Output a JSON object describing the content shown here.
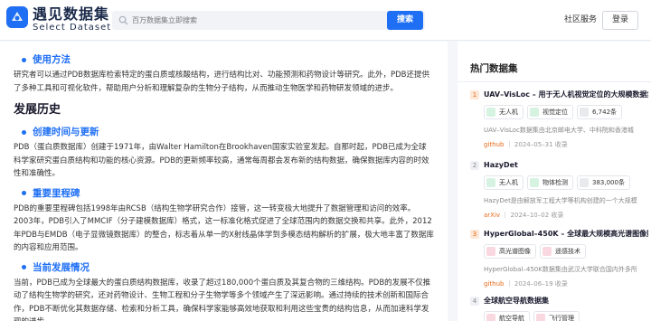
{
  "header": {
    "brand_cn": "遇见数据集",
    "brand_en": "Select Dataset",
    "search_placeholder": "百万数据集立即搜索",
    "search_button": "搜索",
    "nav_community": "社区服务",
    "login_button": "登录"
  },
  "main": {
    "usage": {
      "heading": "使用方法",
      "text": "研究者可以通过PDB数据库检索特定的蛋白质或核酸结构，进行结构比对、功能预测和药物设计等研究。此外，PDB还提供了多种工具和可视化软件，帮助用户分析和理解复杂的生物分子结构，从而推动生物医学和药物研发领域的进步。"
    },
    "history_title": "发展历史",
    "creation": {
      "heading": "创建时间与更新",
      "text": "PDB（蛋白质数据库）创建于1971年，由Walter Hamilton在Brookhaven国家实验室发起。自那时起，PDB已成为全球科学家研究蛋白质结构和功能的核心资源。PDB的更新频率较高，通常每周都会发布新的结构数据，确保数据库内容的时效性和准确性。"
    },
    "milestones": {
      "heading": "重要里程碑",
      "text": "PDB的重要里程碑包括1998年由RCSB（结构生物学研究合作）接管，这一转变极大地提升了数据管理和访问的效率。2003年，PDB引入了MMCIF（分子建模数据库）格式，这一标准化格式促进了全球范围内的数据交换和共享。此外，2012年PDB与EMDB（电子显微镜数据库）的整合，标志着从单一的X射线晶体学到多模态结构解析的扩展，极大地丰富了数据库的内容和应用范围。"
    },
    "current": {
      "heading": "当前发展情况",
      "text": "当前，PDB已成为全球最大的蛋白质结构数据库，收录了超过180,000个蛋白质及其复合物的三维结构。PDB的发展不仅推动了结构生物学的研究，还对药物设计、生物工程和分子生物学等多个领域产生了深远影响。通过持续的技术创新和国际合作，PDB不断优化其数据存储、检索和分析工具，确保科学家能够高效地获取和利用这些宝贵的结构信息，从而加速科学发现的进步。"
    }
  },
  "sidebar": {
    "title": "热门数据集",
    "items": [
      {
        "rank": "1",
        "title": "UAV–VisLoc – 用于无人机视觉定位的大规模数据集",
        "tags": [
          "无人机",
          "视觉定位"
        ],
        "count": "6,742条",
        "desc": "UAV–VisLoc数据集由北京邮电大学、中科院和香港城",
        "source": "github",
        "date": "2024–05–31",
        "action": "收录"
      },
      {
        "rank": "2",
        "title": "HazyDet",
        "tags": [
          "无人机",
          "物体检测"
        ],
        "count": "383,000条",
        "desc": "HazyDet是由解放军工程大学等机构创建的一个大规模",
        "source": "arXiv",
        "date": "2024–10–02",
        "action": "收录"
      },
      {
        "rank": "3",
        "title": "HyperGlobal–450K – 全球最大规模高光谱图像数据集",
        "tags": [
          "高光谱图像",
          "遥感技术"
        ],
        "desc": "HyperGlobal–450K数据集由武汉大学联合国内外多所",
        "source": "github",
        "date": "2024–06–19",
        "action": "收录"
      },
      {
        "rank": "4",
        "title": "全球航空导航数据集",
        "tags": [
          "航空导航",
          "飞行管理"
        ]
      }
    ]
  },
  "colors": {
    "accent": "#1f6ff5",
    "rank_highlight": "#e36a1a"
  }
}
